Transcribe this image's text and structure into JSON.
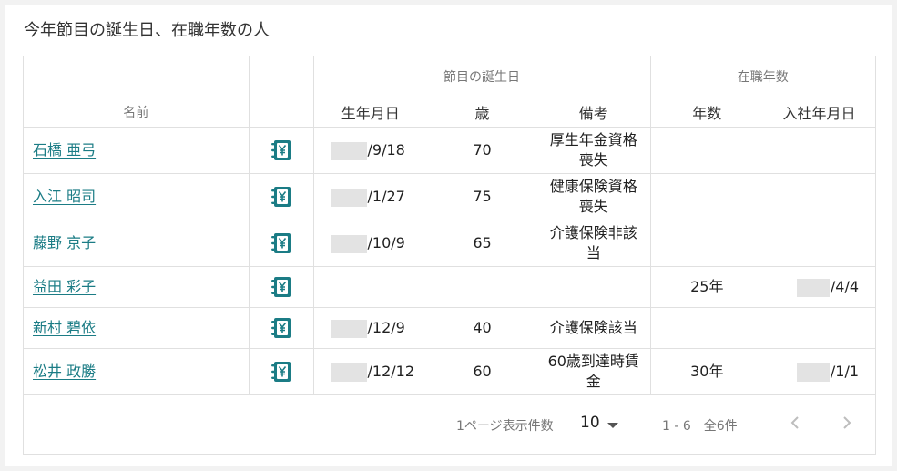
{
  "card_title": "今年節目の誕生日、在職年数の人",
  "table": {
    "groups": {
      "milestone_birthday": "節目の誕生日",
      "years_of_service": "在職年数"
    },
    "columns": {
      "name": "名前",
      "birthdate": "生年月日",
      "age": "歳",
      "note": "備考",
      "years": "年数",
      "hire_date": "入社年月日"
    },
    "rows": [
      {
        "name": "石橋 亜弓",
        "birthdate": "/9/18",
        "age": "70",
        "note_line1": "厚生年金資格",
        "note_line2": "喪失",
        "years": "",
        "hire_date": ""
      },
      {
        "name": "入江 昭司",
        "birthdate": "/1/27",
        "age": "75",
        "note_line1": "健康保険資格",
        "note_line2": "喪失",
        "years": "",
        "hire_date": ""
      },
      {
        "name": "藤野 京子",
        "birthdate": "/10/9",
        "age": "65",
        "note_line1": "介護保険非該",
        "note_line2": "当",
        "years": "",
        "hire_date": ""
      },
      {
        "name": "益田 彩子",
        "birthdate": "",
        "age": "",
        "note_line1": "",
        "note_line2": "",
        "years": "25年",
        "hire_date": "/4/4"
      },
      {
        "name": "新村 碧依",
        "birthdate": "/12/9",
        "age": "40",
        "note_line1": "介護保険該当",
        "note_line2": "",
        "years": "",
        "hire_date": ""
      },
      {
        "name": "松井 政勝",
        "birthdate": "/12/12",
        "age": "60",
        "note_line1": "60歳到達時賃",
        "note_line2": "金",
        "years": "30年",
        "hire_date": "/1/1"
      }
    ]
  },
  "pagination": {
    "per_page_label": "1ページ表示件数",
    "per_page_value": "10",
    "range": "1 - 6　全6件"
  },
  "colors": {
    "link": "#1b7c85",
    "icon": "#1b7c85",
    "border": "#e0e0e0"
  },
  "icons": {
    "row_action": "ledger-yen-icon",
    "prev": "chevron-left-icon",
    "next": "chevron-right-icon"
  }
}
